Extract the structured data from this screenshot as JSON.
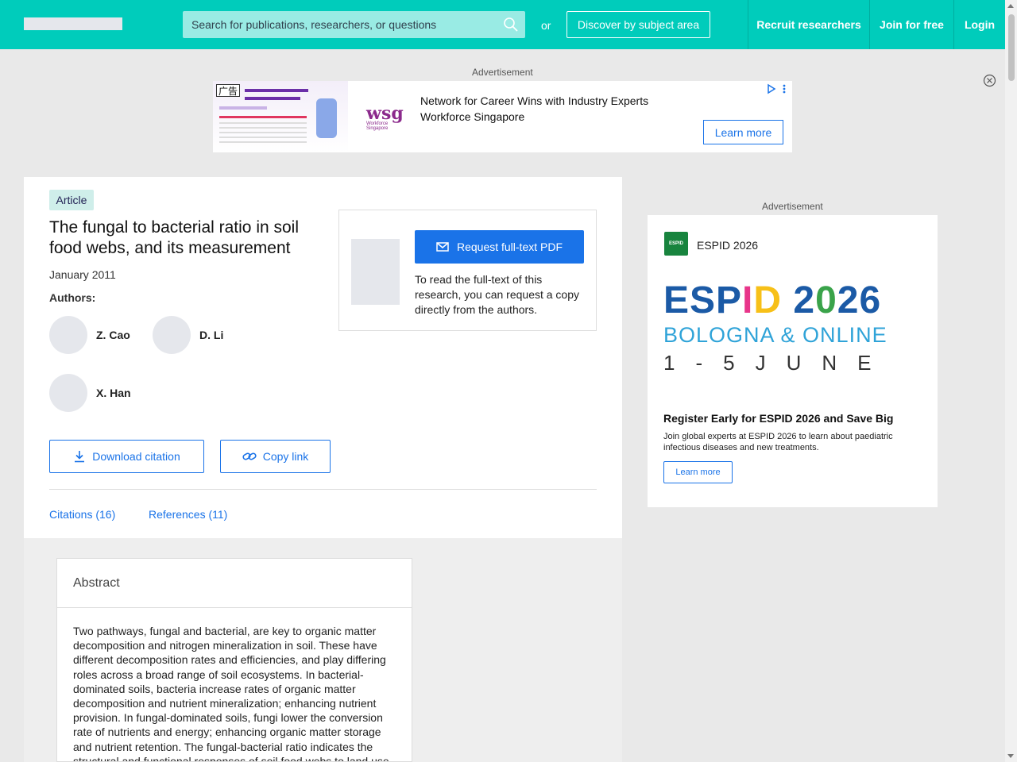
{
  "header": {
    "search_placeholder": "Search for publications, researchers, or questions",
    "or_text": "or",
    "discover_label": "Discover by subject area",
    "recruit_label": "Recruit researchers",
    "join_label": "Join for free",
    "login_label": "Login"
  },
  "ads": {
    "label": "Advertisement",
    "top": {
      "tag": "广告",
      "logo_text": "wsg",
      "logo_sub": "Workforce Singapore",
      "line1": "Network for Career Wins with Industry Experts",
      "line2": "Workforce Singapore",
      "cta": "Learn more"
    },
    "right": {
      "brand_badge": "ESPID",
      "brand": "ESPID 2026",
      "graphic": {
        "w1": "ESP",
        "w2": "I",
        "w3": "D",
        "w4": " 2",
        "w5": "0",
        "w6": "26",
        "line2": "BOLOGNA & ONLINE",
        "line3": "1-5JUNE"
      },
      "headline": "Register Early for ESPID 2026 and Save Big",
      "description": "Join global experts at ESPID 2026 to learn about paediatric infectious diseases and new treatments.",
      "cta": "Learn more"
    }
  },
  "article": {
    "badge": "Article",
    "title": "The fungal to bacterial ratio in soil food webs, and its measurement",
    "date": "January 2011",
    "authors_label": "Authors:",
    "authors": [
      "Z. Cao",
      "D. Li",
      "X. Han"
    ],
    "download_citation": "Download citation",
    "copy_link": "Copy link",
    "tabs": {
      "citations": "Citations (16)",
      "references": "References (11)"
    },
    "request": {
      "button": "Request full-text PDF",
      "text": "To read the full-text of this research, you can request a copy directly from the authors."
    },
    "abstract": {
      "heading": "Abstract",
      "body": "Two pathways, fungal and bacterial, are key to organic matter decomposition and nitrogen mineralization in soil. These have different decomposition rates and efficiencies, and play differing roles across a broad range of soil ecosystems. In bacterial-dominated soils, bacteria increase rates of organic matter decomposition and nutrient mineralization; enhancing nutrient provision. In fungal-dominated soils, fungi lower the conversion rate of nutrients and energy; enhancing organic matter storage and nutrient retention. The fungal-bacterial ratio indicates the structural and functional responses of soil food webs to land use"
    }
  }
}
